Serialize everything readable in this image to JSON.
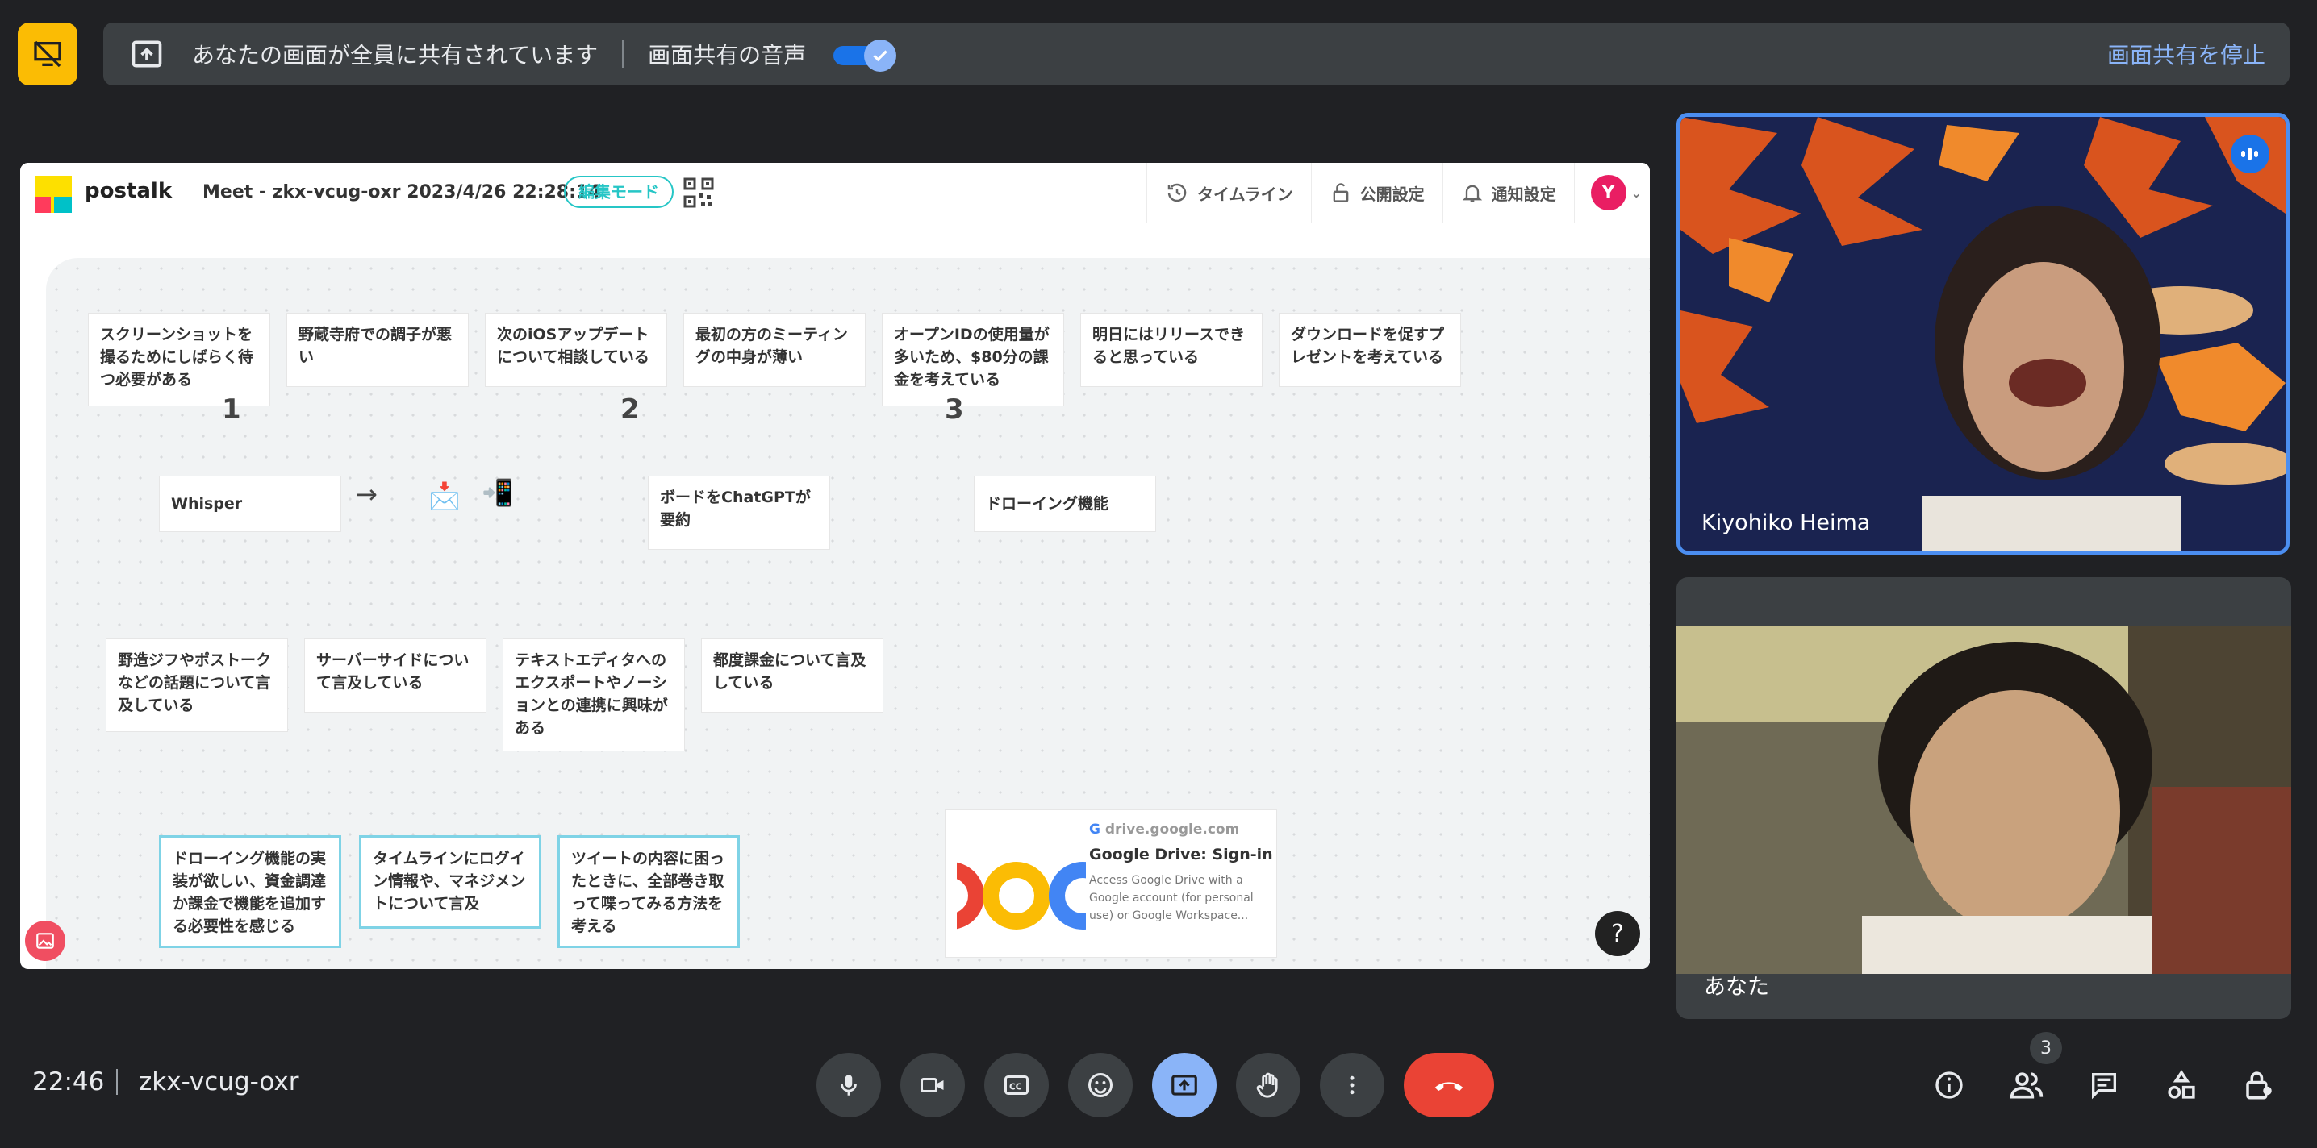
{
  "share_bar": {
    "message": "あなたの画面が全員に共有されています",
    "audio_label": "画面共有の音声",
    "stop_label": "画面共有を停止"
  },
  "postalk": {
    "brand": "postalk",
    "title": "Meet - zkx-vcug-oxr 2023/4/26 22:28:14",
    "mode_badge": "編集モード",
    "nav": {
      "timeline": "タイムライン",
      "public": "公開設定",
      "notify": "通知設定"
    },
    "avatar_initial": "Y",
    "numbers": [
      "1",
      "2",
      "3"
    ],
    "notes_top": [
      "スクリーンショットを撮るためにしばらく待つ必要がある",
      "野蔵寺府での調子が悪い",
      "次のiOSアップデートについて相談している",
      "最初の方のミーティングの中身が薄い",
      "オープンIDの使用量が多いため、$80分の課金を考えている",
      "明日にはリリースできると思っている",
      "ダウンロードを促すプレゼントを考えている"
    ],
    "notes_mid": [
      "Whisper",
      "ボードをChatGPTが要約",
      "ドローイング機能"
    ],
    "arrow": "→",
    "notes_lower": [
      "野造ジフやポストークなどの話題について言及している",
      "サーバーサイドについて言及している",
      "テキストエディタへのエクスポートやノーションとの連携に興味がある",
      "都度課金について言及している"
    ],
    "notes_blue": [
      "ドローイング機能の実装が欲しい、資金調達か課金で機能を追加する必要性を感じる",
      "タイムラインにログイン情報や、マネジメントについて言及",
      "ツイートの内容に困ったときに、全部巻き取って喋ってみる方法を考える"
    ],
    "link_card": {
      "domain": "drive.google.com",
      "title": "Google Drive: Sign-in",
      "description": "Access Google Drive with a Google account (for personal use) or Google Workspace..."
    },
    "help": "?"
  },
  "participants": {
    "remote_name": "Kiyohiko Heima",
    "self_name": "あなた"
  },
  "bottom": {
    "time": "22:46",
    "meeting_code": "zkx-vcug-oxr",
    "people_count": "3"
  },
  "colors": {
    "accent": "#8ab4f8",
    "end_call": "#ea4335",
    "warn": "#fbbc04",
    "postalk_teal": "#26c6c6"
  }
}
